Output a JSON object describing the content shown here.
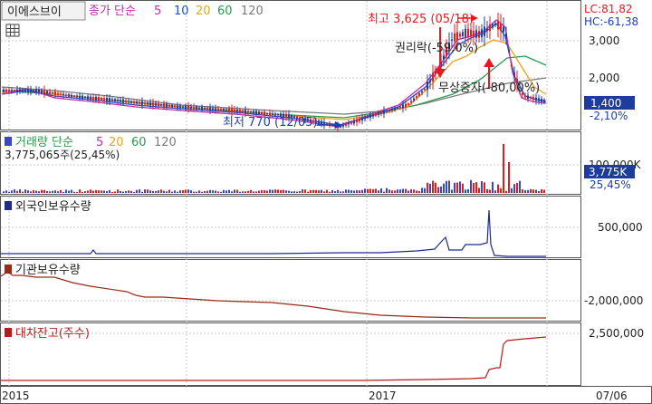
{
  "colors": {
    "background": "#ffffff",
    "grid": "#c8c8c8",
    "panel_border": "#555555",
    "candle_up": "#e8191d",
    "candle_down": "#1f3fa8",
    "ma5": "#c32caa",
    "ma10": "#1d4fd0",
    "ma20": "#f0a21b",
    "ma60": "#2b9a4d",
    "ma120": "#7a7a7a",
    "volume": "#3a46c8",
    "foreign": "#1e2b8f",
    "institution": "#9a2a18",
    "loan": "#b31d1d",
    "accent_blue": "#1c3fb8",
    "axis_badge_bg": "#1d3c9c"
  },
  "price_panel": {
    "title": "이에스브이",
    "ma_label": "종가 단순",
    "ma_periods": [
      "5",
      "10",
      "20",
      "60",
      "120"
    ],
    "icon": "grid-icon",
    "lc_label": "LC:81,82",
    "hc_label": "HC:-61,38",
    "y_ticks": [
      "3,000",
      "2,000"
    ],
    "current_price": "1,400",
    "change_pct": "-2,10%",
    "annotation_high": "최고 3,625 (05/18)",
    "annotation_low": "최저 770 (12/05)",
    "annotation_rights": "권리락(-59,0%)",
    "annotation_bonus": "무상증자(-80,00%)"
  },
  "volume_panel": {
    "title": "거래량 단순",
    "ma_periods": [
      "5",
      "20",
      "60",
      "120"
    ],
    "value_label": "3,775,065주(25,45%)",
    "y_tick": "100,000K",
    "current": "3,775K",
    "pct": "25,45%"
  },
  "foreign_panel": {
    "title": "외국인보유수량",
    "y_tick": "500,000"
  },
  "institution_panel": {
    "title": "기관보유수량",
    "y_tick": "-2,000,000"
  },
  "loan_panel": {
    "title": "대차잔고(주수)",
    "y_tick": "2,500,000"
  },
  "x_axis": {
    "labels": [
      "2015",
      "2017",
      "07/06"
    ]
  }
}
